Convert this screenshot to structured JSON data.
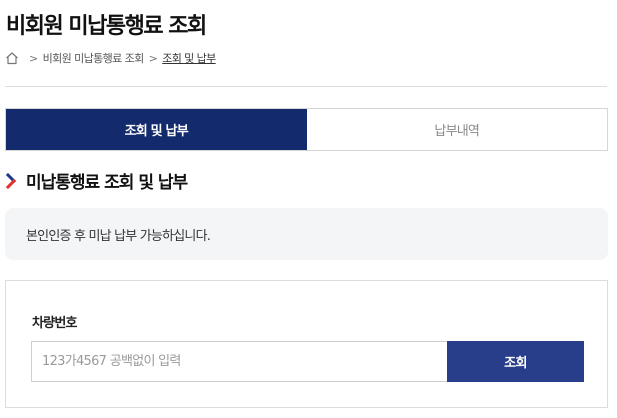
{
  "page": {
    "title": "비회원 미납통행료 조회"
  },
  "breadcrumb": {
    "icon": "home-icon",
    "items": [
      "비회원 미납통행료 조회",
      "조회 및 납부"
    ]
  },
  "tabs": [
    {
      "label": "조회 및 납부",
      "active": true
    },
    {
      "label": "납부내역",
      "active": false
    }
  ],
  "section": {
    "icon": "chevron-right-icon",
    "title": "미납통행료 조회 및 납부"
  },
  "notice": {
    "text": "본인인증 후 미납 납부 가능하십니다."
  },
  "search": {
    "label": "차량번호",
    "placeholder": "123가4567 공백없이 입력",
    "value": "",
    "button_label": "조회"
  },
  "colors": {
    "active_tab": "#132b6d",
    "button": "#283e8a",
    "chevron_primary": "#1d3a8a",
    "chevron_accent": "#e0322c",
    "notice_bg": "#f4f5f7"
  }
}
